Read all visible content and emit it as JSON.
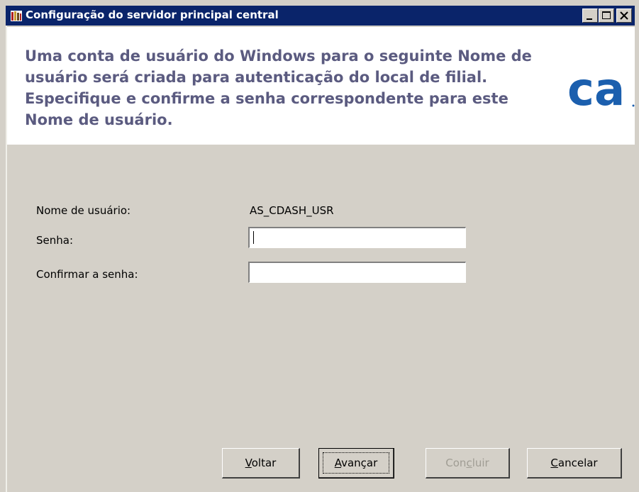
{
  "window": {
    "title": "Configuração do servidor principal central"
  },
  "header": {
    "instructions": "Uma conta de usuário do Windows para o seguinte Nome de usuário será criada para autenticação do local de filial. Especifique e confirme a senha correspondente para este Nome de usuário.",
    "logo_text": "ca",
    "logo_color": "#1b5fae"
  },
  "form": {
    "username_label": "Nome de usuário:",
    "username_value": "AS_CDASH_USR",
    "password_label": "Senha:",
    "password_value": "",
    "confirm_label": "Confirmar a senha:",
    "confirm_value": ""
  },
  "buttons": {
    "back": {
      "pre": "",
      "mnemonic": "V",
      "post": "oltar"
    },
    "next": {
      "pre": "",
      "mnemonic": "A",
      "post": "vançar"
    },
    "finish": {
      "pre": "Con",
      "mnemonic": "c",
      "post": "luir"
    },
    "cancel": {
      "pre": "",
      "mnemonic": "C",
      "post": "ancelar"
    }
  },
  "titlebar_controls": [
    "minimize-icon",
    "maximize-icon",
    "close-icon"
  ]
}
